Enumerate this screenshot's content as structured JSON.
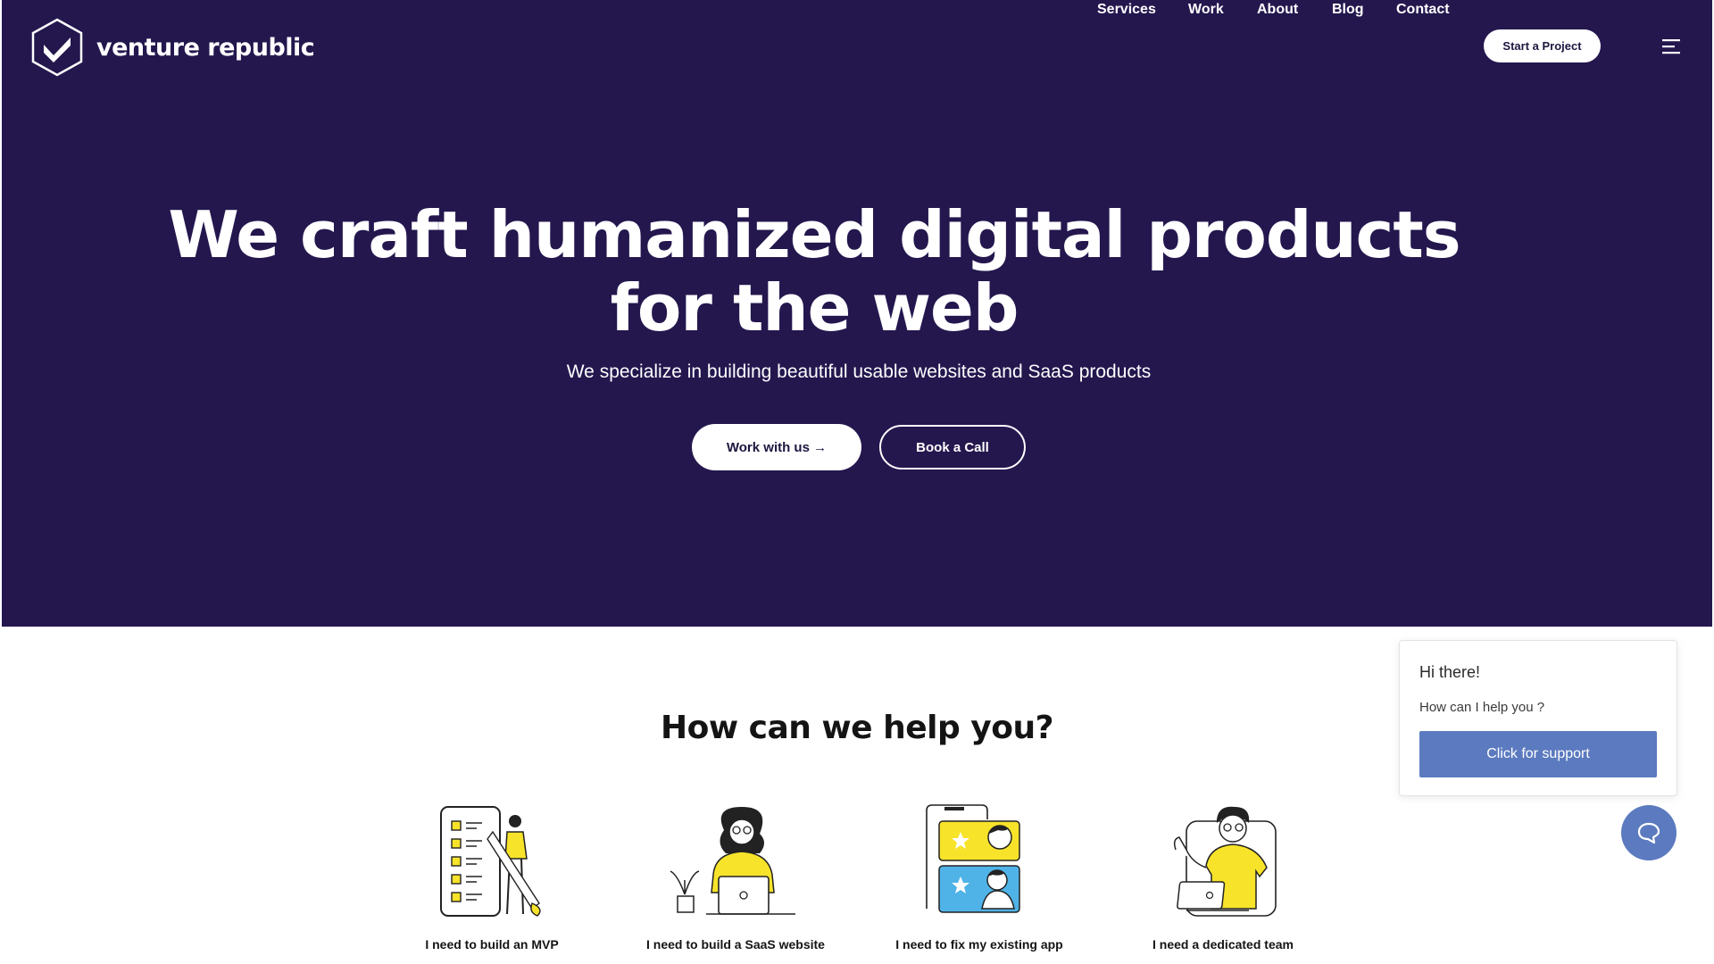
{
  "brand": {
    "name": "venture republic",
    "logo_icon": "chevron-hexagon-logo"
  },
  "nav": {
    "items": [
      {
        "label": "Services"
      },
      {
        "label": "Work"
      },
      {
        "label": "About"
      },
      {
        "label": "Blog"
      },
      {
        "label": "Contact"
      }
    ],
    "cta_label": "Start a Project",
    "menu_icon": "hamburger-icon"
  },
  "hero": {
    "title_line1": "We craft humanized digital products",
    "title_line2": "for the web",
    "subtitle": "We specialize in building beautiful usable websites and SaaS products",
    "primary_label": "Work with us →",
    "secondary_label": "Book a Call",
    "background": "#24174e"
  },
  "help": {
    "title": "How can we help you?",
    "cards": [
      {
        "label": "I need to build an MVP",
        "icon": "mvp-illustration"
      },
      {
        "label": "I need to build a SaaS website",
        "icon": "laptop-woman-illustration"
      },
      {
        "label": "I need to fix my existing app",
        "icon": "review-stars-illustration"
      },
      {
        "label": "I need a dedicated team",
        "icon": "team-member-illustration"
      }
    ]
  },
  "chat": {
    "greeting": "Hi there!",
    "question": "How can I help you ?",
    "button_label": "Click for support",
    "accent": "#5b7abf",
    "fab_icon": "chat-bubble-icon"
  },
  "colors": {
    "accent_yellow": "#f7e32a",
    "text_dark": "#141414"
  }
}
